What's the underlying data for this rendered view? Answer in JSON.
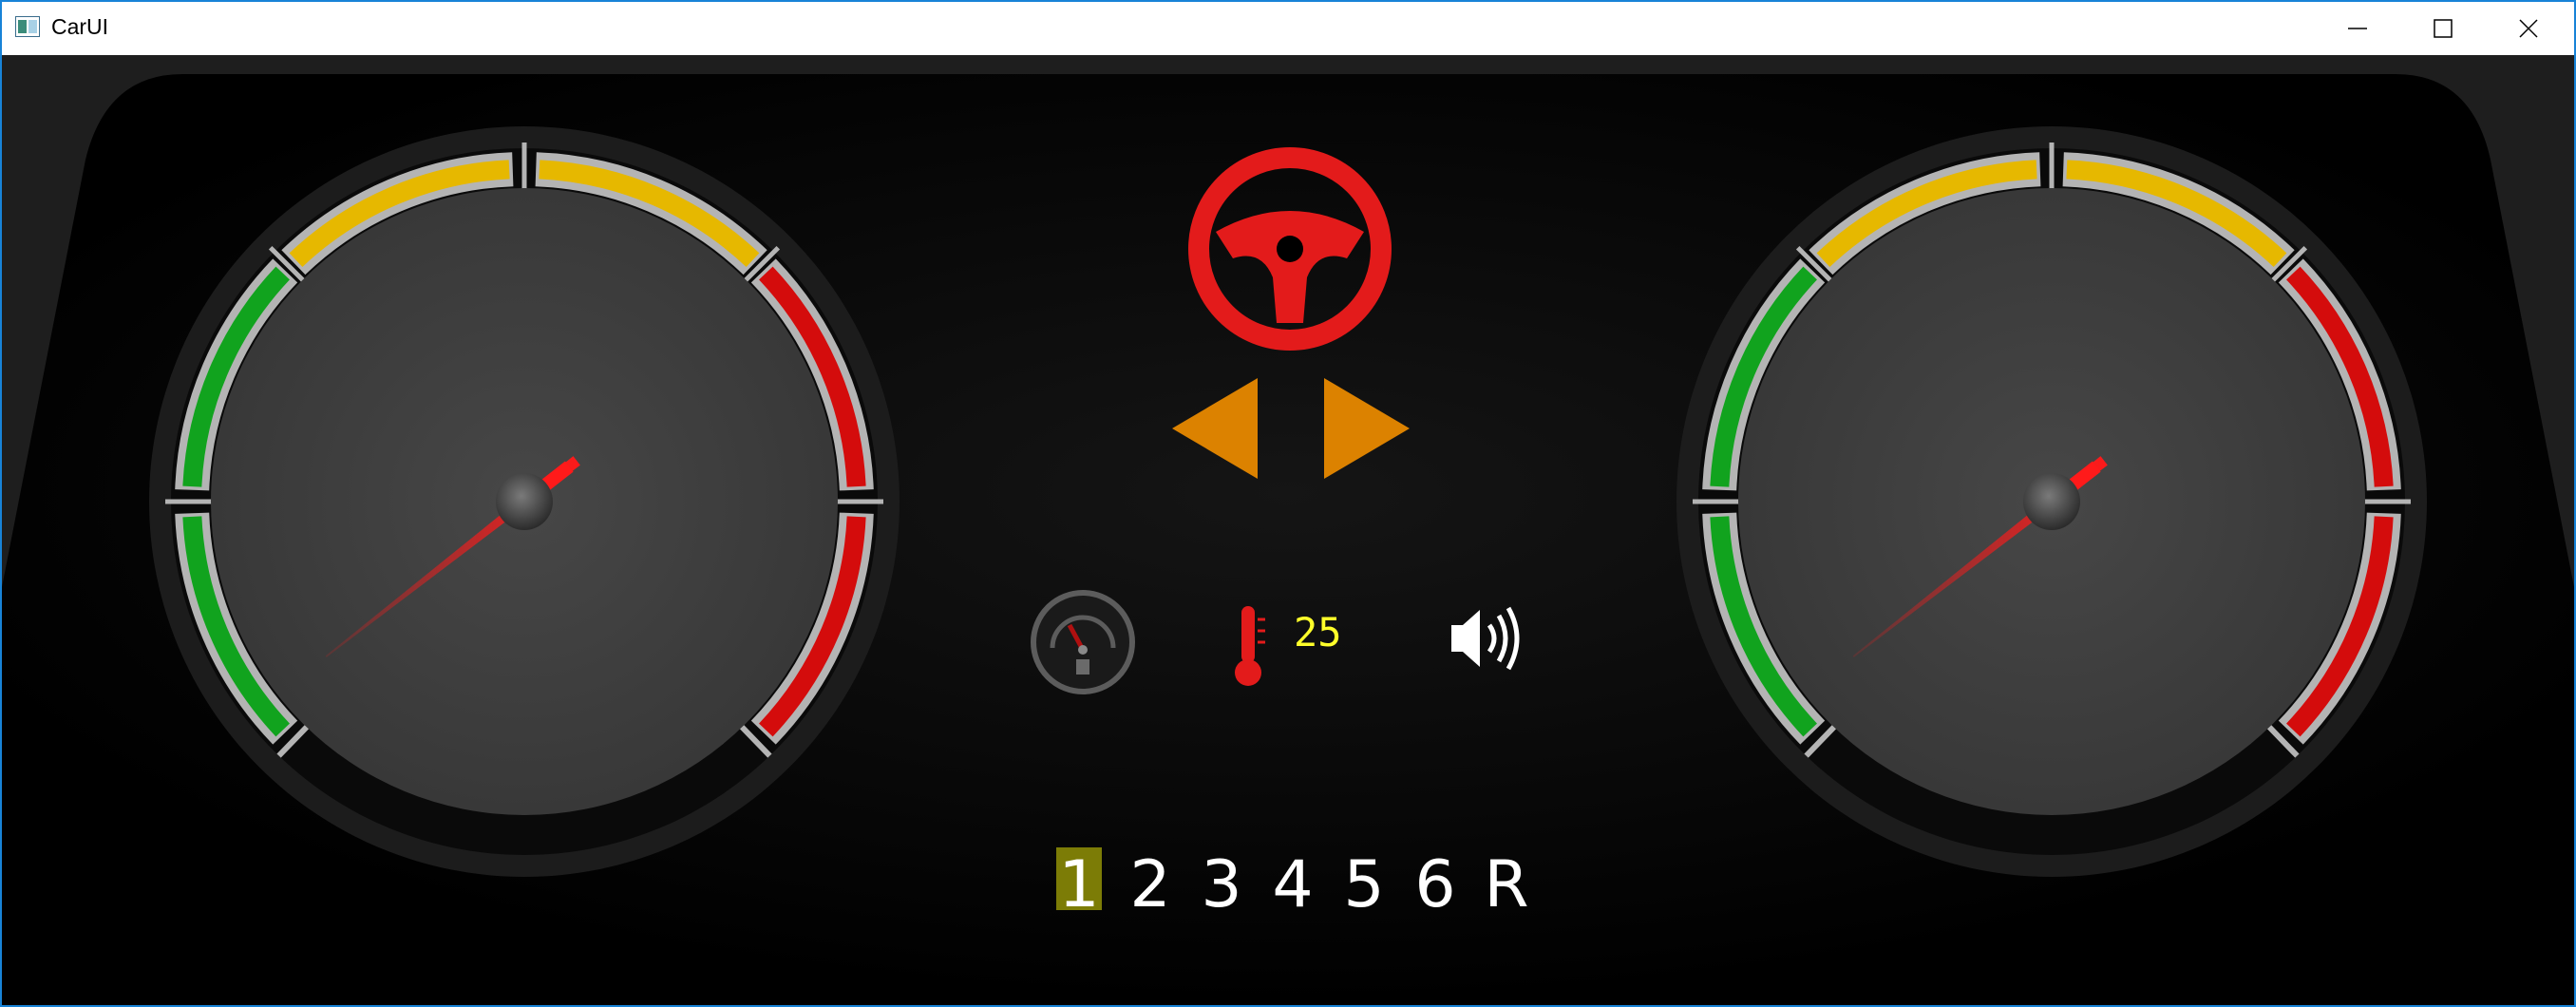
{
  "window": {
    "title": "CarUI",
    "buttons": [
      "minimize",
      "maximize",
      "close"
    ],
    "accent_border": "#1883d7"
  },
  "gauges": [
    {
      "name": "left-gauge",
      "needle_angle_deg": 232
    },
    {
      "name": "right-gauge",
      "needle_angle_deg": 232
    }
  ],
  "indicators": {
    "steering_icon": "steering-wheel-icon",
    "steering_color": "#e31b1b",
    "turn_signals": [
      "left-arrow-icon",
      "right-arrow-icon"
    ],
    "turn_color": "#dc8200",
    "fuel_icon": "fuel-gauge-icon",
    "temperature_icon": "thermometer-icon",
    "temperature": "25",
    "sound_icon": "speaker-icon"
  },
  "gears": {
    "items": [
      "1",
      "2",
      "3",
      "4",
      "5",
      "6",
      "R"
    ],
    "active": "1",
    "active_bg": "#7c7c06",
    "reverse_color": "#ff1010"
  },
  "colors": {
    "green": "#11a31e",
    "yellow": "#e6b800",
    "red": "#d40c0c",
    "needle": "#ff1a1a"
  }
}
